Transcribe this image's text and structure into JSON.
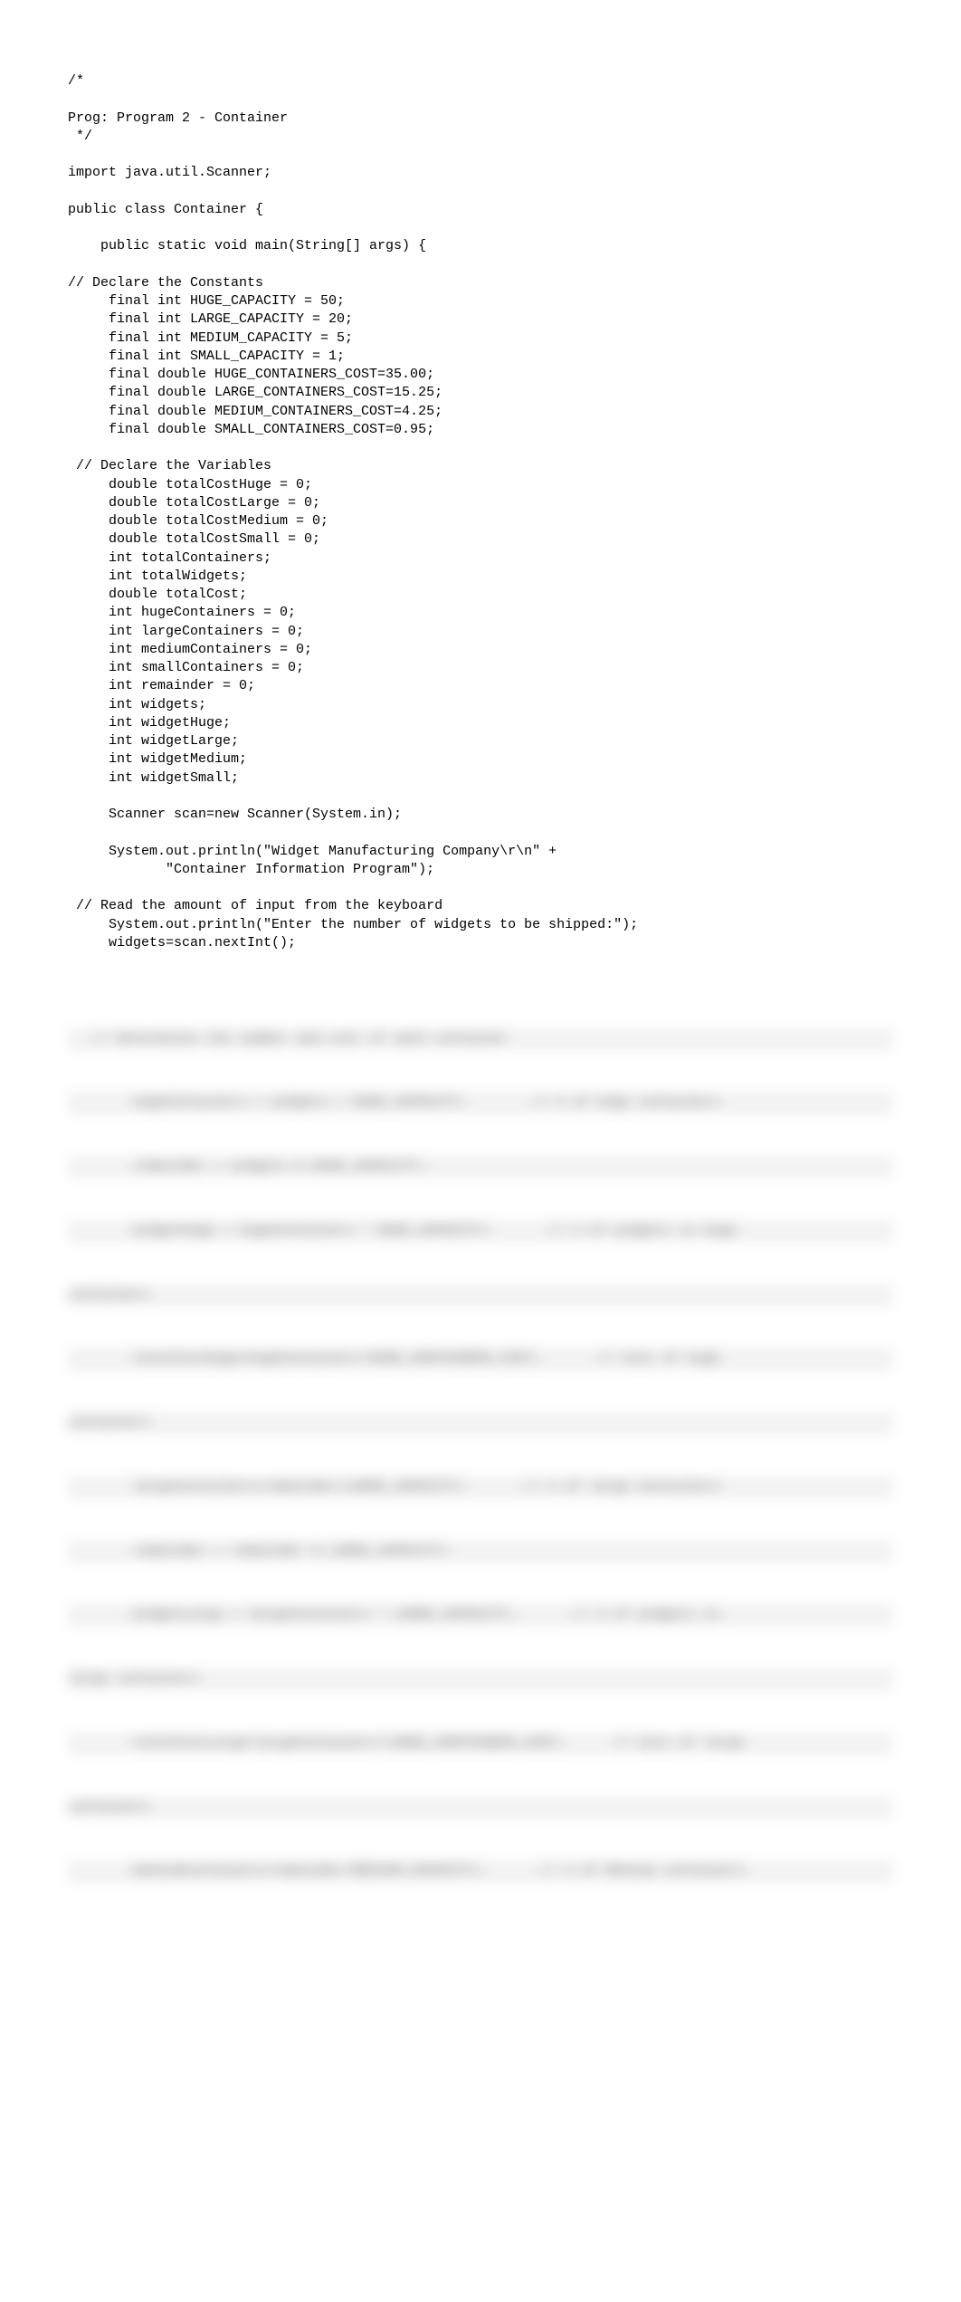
{
  "code": {
    "lines": [
      "/*",
      "",
      "Prog: Program 2 - Container",
      " */",
      "",
      "import java.util.Scanner;",
      "",
      "public class Container {",
      "",
      "    public static void main(String[] args) {",
      "",
      "// Declare the Constants",
      "     final int HUGE_CAPACITY = 50;",
      "     final int LARGE_CAPACITY = 20;",
      "     final int MEDIUM_CAPACITY = 5;",
      "     final int SMALL_CAPACITY = 1;",
      "     final double HUGE_CONTAINERS_COST=35.00;",
      "     final double LARGE_CONTAINERS_COST=15.25;",
      "     final double MEDIUM_CONTAINERS_COST=4.25;",
      "     final double SMALL_CONTAINERS_COST=0.95;",
      "",
      " // Declare the Variables",
      "     double totalCostHuge = 0;",
      "     double totalCostLarge = 0;",
      "     double totalCostMedium = 0;",
      "     double totalCostSmall = 0;",
      "     int totalContainers;",
      "     int totalWidgets;",
      "     double totalCost;",
      "     int hugeContainers = 0;",
      "     int largeContainers = 0;",
      "     int mediumContainers = 0;",
      "     int smallContainers = 0;",
      "     int remainder = 0;",
      "     int widgets;",
      "     int widgetHuge;",
      "     int widgetLarge;",
      "     int widgetMedium;",
      "     int widgetSmall;",
      "",
      "     Scanner scan=new Scanner(System.in);",
      "",
      "     System.out.println(\"Widget Manufacturing Company\\r\\n\" +",
      "            \"Container Information Program\");",
      "",
      " // Read the amount of input from the keyboard",
      "     System.out.println(\"Enter the number of widgets to be shipped:\");",
      "     widgets=scan.nextInt();",
      ""
    ]
  },
  "blurred": {
    "lines": [
      "   // Determines the number and cost of each container                    ",
      "        hugeContainers = widgets / HUGE_CAPACITY;        // # of huge containers  ",
      "        remainder = widgets % HUGE_CAPACITY;",
      "        widgetHuge = hugeContainers * HUGE_CAPACITY;       // # of widgets in huge",
      "containers",
      "        totalCostHuge=hugeContainers*HUGE_CONTAINERS_COST;       // Cost of huge",
      "containers",
      "        largeContainers=remainder/LARGE_CAPACITY;       // # of large Containers ",
      "        remainder = remainder % LARGE_CAPACITY;",
      "        widgetLarge = largeContainers * LARGE_CAPACITY;       // # of widgets in",
      "large containers",
      "        totalCostLarge=largeContainers*LARGE_CONTAINERS_COST;      // Cost of large",
      "containers",
      "        mediumContainers=remainder/MEDIUM_CAPACITY;       // # of Medium containers "
    ]
  }
}
